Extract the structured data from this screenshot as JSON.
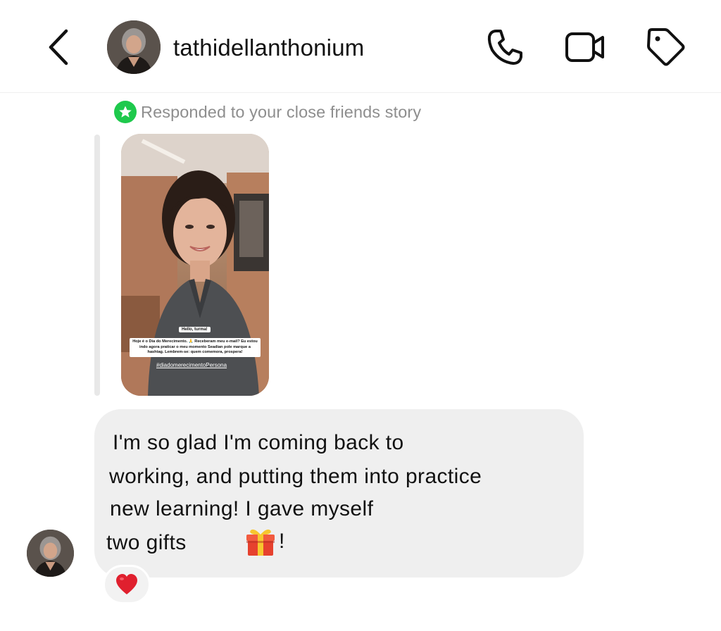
{
  "header": {
    "username": "tathidellanthonium",
    "icons": {
      "back": "chevron-left-icon",
      "call": "phone-icon",
      "video": "video-camera-icon",
      "tag": "tag-icon"
    }
  },
  "story_reply": {
    "context_text": "Responded to your close friends story",
    "badge_icon": "star-icon",
    "badge_color": "#1ec94c",
    "thumbnail": {
      "hello_text": "Hello, turma!",
      "caption_text": "Hoje é o Dia do Merecimento. 🙏 Receberam meu e-mail? Eu estou indo agora praticar o meu momento Seadian pole marque a hashtag. Lembrem-se: quem comemora, prospera!",
      "hashtag": "#diadomerecimentoPersona"
    }
  },
  "message": {
    "lines": [
      "I'm so glad I'm coming back to",
      "working, and putting them into practice",
      "new learning! I gave myself",
      "two gifts"
    ],
    "emoji_icon": "gift-icon",
    "trailing": "!"
  },
  "reaction": {
    "icon": "red-heart-icon",
    "color": "#e0202e"
  }
}
